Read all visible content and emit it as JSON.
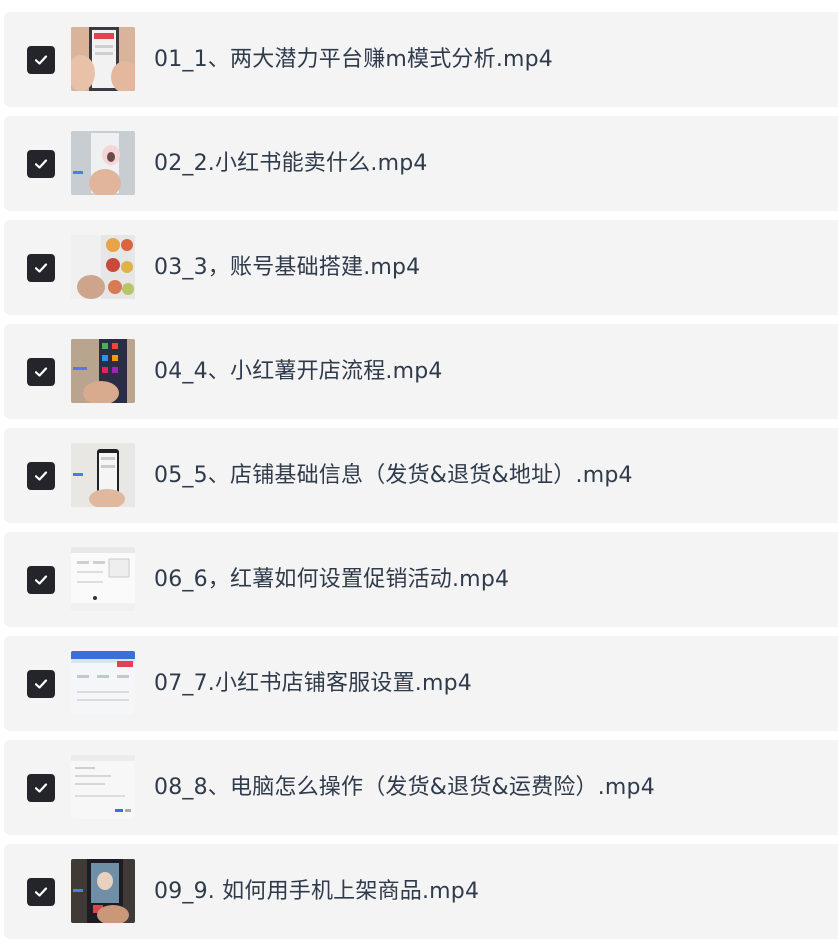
{
  "files": [
    {
      "name": "01_1、两大潜力平台赚m模式分析.mp4",
      "checked": true
    },
    {
      "name": "02_2.小红书能卖什么.mp4",
      "checked": true
    },
    {
      "name": "03_3，账号基础搭建.mp4",
      "checked": true
    },
    {
      "name": "04_4、小红薯开店流程.mp4",
      "checked": true
    },
    {
      "name": "05_5、店铺基础信息（发货&退货&地址）.mp4",
      "checked": true
    },
    {
      "name": "06_6，红薯如何设置促销活动.mp4",
      "checked": true
    },
    {
      "name": "07_7.小红书店铺客服设置.mp4",
      "checked": true
    },
    {
      "name": "08_8、电脑怎么操作（发货&退货&运费险）.mp4",
      "checked": true
    },
    {
      "name": "09_9. 如何用手机上架商品.mp4",
      "checked": true
    }
  ],
  "colors": {
    "row_background": "#f4f4f5",
    "checkbox_fill": "#23252a",
    "text": "#2f3a4a"
  },
  "icons": {
    "checkbox": "checkmark-icon",
    "thumbnail": "video-thumbnail"
  }
}
